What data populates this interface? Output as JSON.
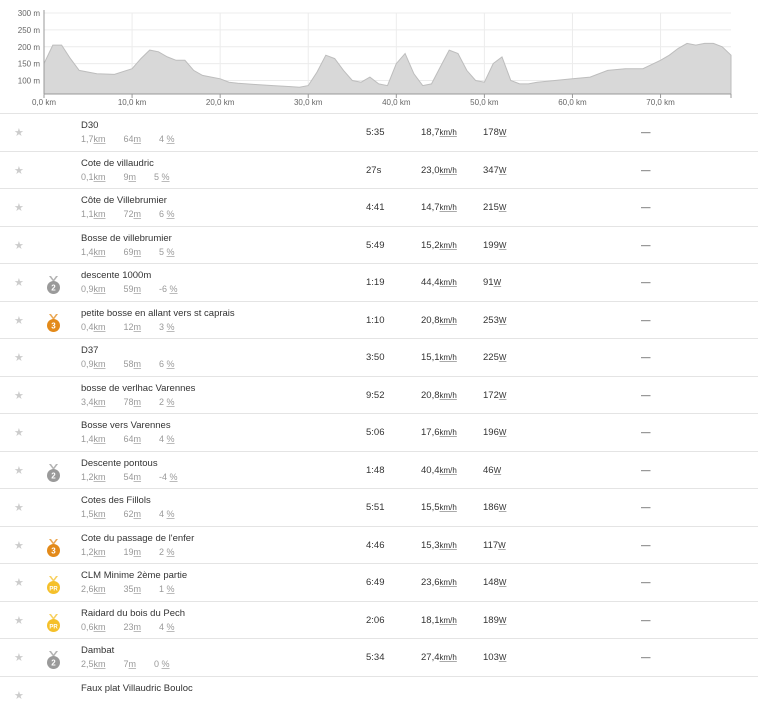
{
  "profile": {
    "y_ticks": [
      "300 m",
      "250 m",
      "200 m",
      "150 m",
      "100 m"
    ],
    "x_ticks": [
      "0,0 km",
      "10,0 km",
      "20,0 km",
      "30,0 km",
      "40,0 km",
      "50,0 km",
      "60,0 km",
      "70,0 km"
    ]
  },
  "chart_data": {
    "type": "area",
    "xlabel": "",
    "ylabel": "",
    "x_unit": "km",
    "y_unit": "m",
    "xlim": [
      0,
      78
    ],
    "ylim": [
      60,
      300
    ],
    "grid": true,
    "x": [
      0,
      1,
      2,
      3,
      4,
      6,
      8,
      10,
      11,
      12,
      13,
      14,
      15,
      16,
      17,
      18,
      19,
      20,
      21,
      22,
      23,
      24,
      26,
      28,
      29,
      30,
      31,
      32,
      33,
      34,
      35,
      36,
      37,
      38,
      39,
      40,
      41,
      42,
      43,
      44,
      45,
      46,
      47,
      48,
      49,
      50,
      51,
      52,
      53,
      54,
      55,
      56,
      58,
      60,
      62,
      64,
      66,
      68,
      70,
      71,
      72,
      73,
      74,
      75,
      76,
      77,
      78
    ],
    "series": [
      {
        "values": [
          150,
          205,
          205,
          165,
          130,
          120,
          118,
          135,
          165,
          190,
          185,
          170,
          160,
          160,
          130,
          115,
          110,
          105,
          95,
          92,
          90,
          88,
          85,
          82,
          80,
          85,
          125,
          175,
          165,
          130,
          100,
          95,
          110,
          90,
          85,
          150,
          180,
          120,
          85,
          90,
          140,
          190,
          180,
          130,
          100,
          95,
          150,
          170,
          100,
          90,
          90,
          95,
          100,
          105,
          110,
          130,
          135,
          135,
          160,
          175,
          195,
          210,
          205,
          210,
          210,
          200,
          175
        ]
      }
    ]
  },
  "columns": {
    "speed_unit": "km/h",
    "power_unit": "W",
    "dist_unit": "km",
    "elev_unit": "m",
    "grade_unit": "%"
  },
  "segments": [
    {
      "name": "D30",
      "dist": "1,7",
      "elev": "64",
      "grade": "4",
      "time": "5:35",
      "speed": "18,7",
      "power": "178",
      "rank": "—",
      "medal": ""
    },
    {
      "name": "Cote de villaudric",
      "dist": "0,1",
      "elev": "9",
      "grade": "5",
      "time": "27s",
      "speed": "23,0",
      "power": "347",
      "rank": "—",
      "medal": ""
    },
    {
      "name": "Côte de Villebrumier",
      "dist": "1,1",
      "elev": "72",
      "grade": "6",
      "time": "4:41",
      "speed": "14,7",
      "power": "215",
      "rank": "—",
      "medal": ""
    },
    {
      "name": "Bosse de villebrumier",
      "dist": "1,4",
      "elev": "69",
      "grade": "5",
      "time": "5:49",
      "speed": "15,2",
      "power": "199",
      "rank": "—",
      "medal": ""
    },
    {
      "name": "descente 1000m",
      "dist": "0,9",
      "elev": "59",
      "grade": "-6",
      "time": "1:19",
      "speed": "44,4",
      "power": "91",
      "rank": "—",
      "medal": "silver",
      "medal_label": "2"
    },
    {
      "name": "petite bosse en allant vers st caprais",
      "dist": "0,4",
      "elev": "12",
      "grade": "3",
      "time": "1:10",
      "speed": "20,8",
      "power": "253",
      "rank": "—",
      "medal": "bronze",
      "medal_label": "3"
    },
    {
      "name": "D37",
      "dist": "0,9",
      "elev": "58",
      "grade": "6",
      "time": "3:50",
      "speed": "15,1",
      "power": "225",
      "rank": "—",
      "medal": ""
    },
    {
      "name": "bosse de verlhac Varennes",
      "dist": "3,4",
      "elev": "78",
      "grade": "2",
      "time": "9:52",
      "speed": "20,8",
      "power": "172",
      "rank": "—",
      "medal": ""
    },
    {
      "name": "Bosse vers Varennes",
      "dist": "1,4",
      "elev": "64",
      "grade": "4",
      "time": "5:06",
      "speed": "17,6",
      "power": "196",
      "rank": "—",
      "medal": ""
    },
    {
      "name": "Descente pontous",
      "dist": "1,2",
      "elev": "54",
      "grade": "-4",
      "time": "1:48",
      "speed": "40,4",
      "power": "46",
      "rank": "—",
      "medal": "silver",
      "medal_label": "2"
    },
    {
      "name": "Cotes des Fillols",
      "dist": "1,5",
      "elev": "62",
      "grade": "4",
      "time": "5:51",
      "speed": "15,5",
      "power": "186",
      "rank": "—",
      "medal": ""
    },
    {
      "name": "Cote du passage de l'enfer",
      "dist": "1,2",
      "elev": "19",
      "grade": "2",
      "time": "4:46",
      "speed": "15,3",
      "power": "117",
      "rank": "—",
      "medal": "bronze",
      "medal_label": "3"
    },
    {
      "name": "CLM Minime 2ème partie",
      "dist": "2,6",
      "elev": "35",
      "grade": "1",
      "time": "6:49",
      "speed": "23,6",
      "power": "148",
      "rank": "—",
      "medal": "pr",
      "medal_label": "PR"
    },
    {
      "name": "Raidard du bois du Pech",
      "dist": "0,6",
      "elev": "23",
      "grade": "4",
      "time": "2:06",
      "speed": "18,1",
      "power": "189",
      "rank": "—",
      "medal": "pr",
      "medal_label": "PR"
    },
    {
      "name": "Dambat",
      "dist": "2,5",
      "elev": "7",
      "grade": "0",
      "time": "5:34",
      "speed": "27,4",
      "power": "103",
      "rank": "—",
      "medal": "silver",
      "medal_label": "2"
    },
    {
      "name": "Faux plat Villaudric Bouloc",
      "dist": "",
      "elev": "",
      "grade": "",
      "time": "",
      "speed": "",
      "power": "",
      "rank": "",
      "medal": ""
    }
  ],
  "colors": {
    "area_fill": "#d8d8d8",
    "area_stroke": "#bdbdbd",
    "star": "#cccccc",
    "silver": "#9a9a9a",
    "bronze": "#e38a1a",
    "pr": "#f5c02a"
  }
}
